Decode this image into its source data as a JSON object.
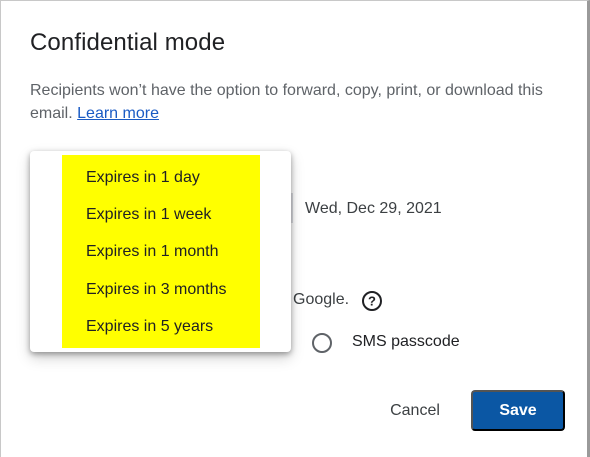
{
  "dialog": {
    "title": "Confidential mode",
    "description": "Recipients won’t have the option to forward, copy, print, or download this email.",
    "learn_more": "Learn more"
  },
  "expiration": {
    "date": "Wed, Dec 29, 2021",
    "options": [
      "Expires in 1 day",
      "Expires in 1 week",
      "Expires in 1 month",
      "Expires in 3 months",
      "Expires in 5 years"
    ],
    "highlight_color": "#ffff00"
  },
  "passcode": {
    "google_text": "Google.",
    "sms_label": "SMS passcode",
    "help_icon": "help-circle-icon"
  },
  "actions": {
    "cancel": "Cancel",
    "save": "Save"
  },
  "colors": {
    "primary": "#0b57a4",
    "link": "#1a5bc4",
    "text_secondary": "#5f6368"
  }
}
